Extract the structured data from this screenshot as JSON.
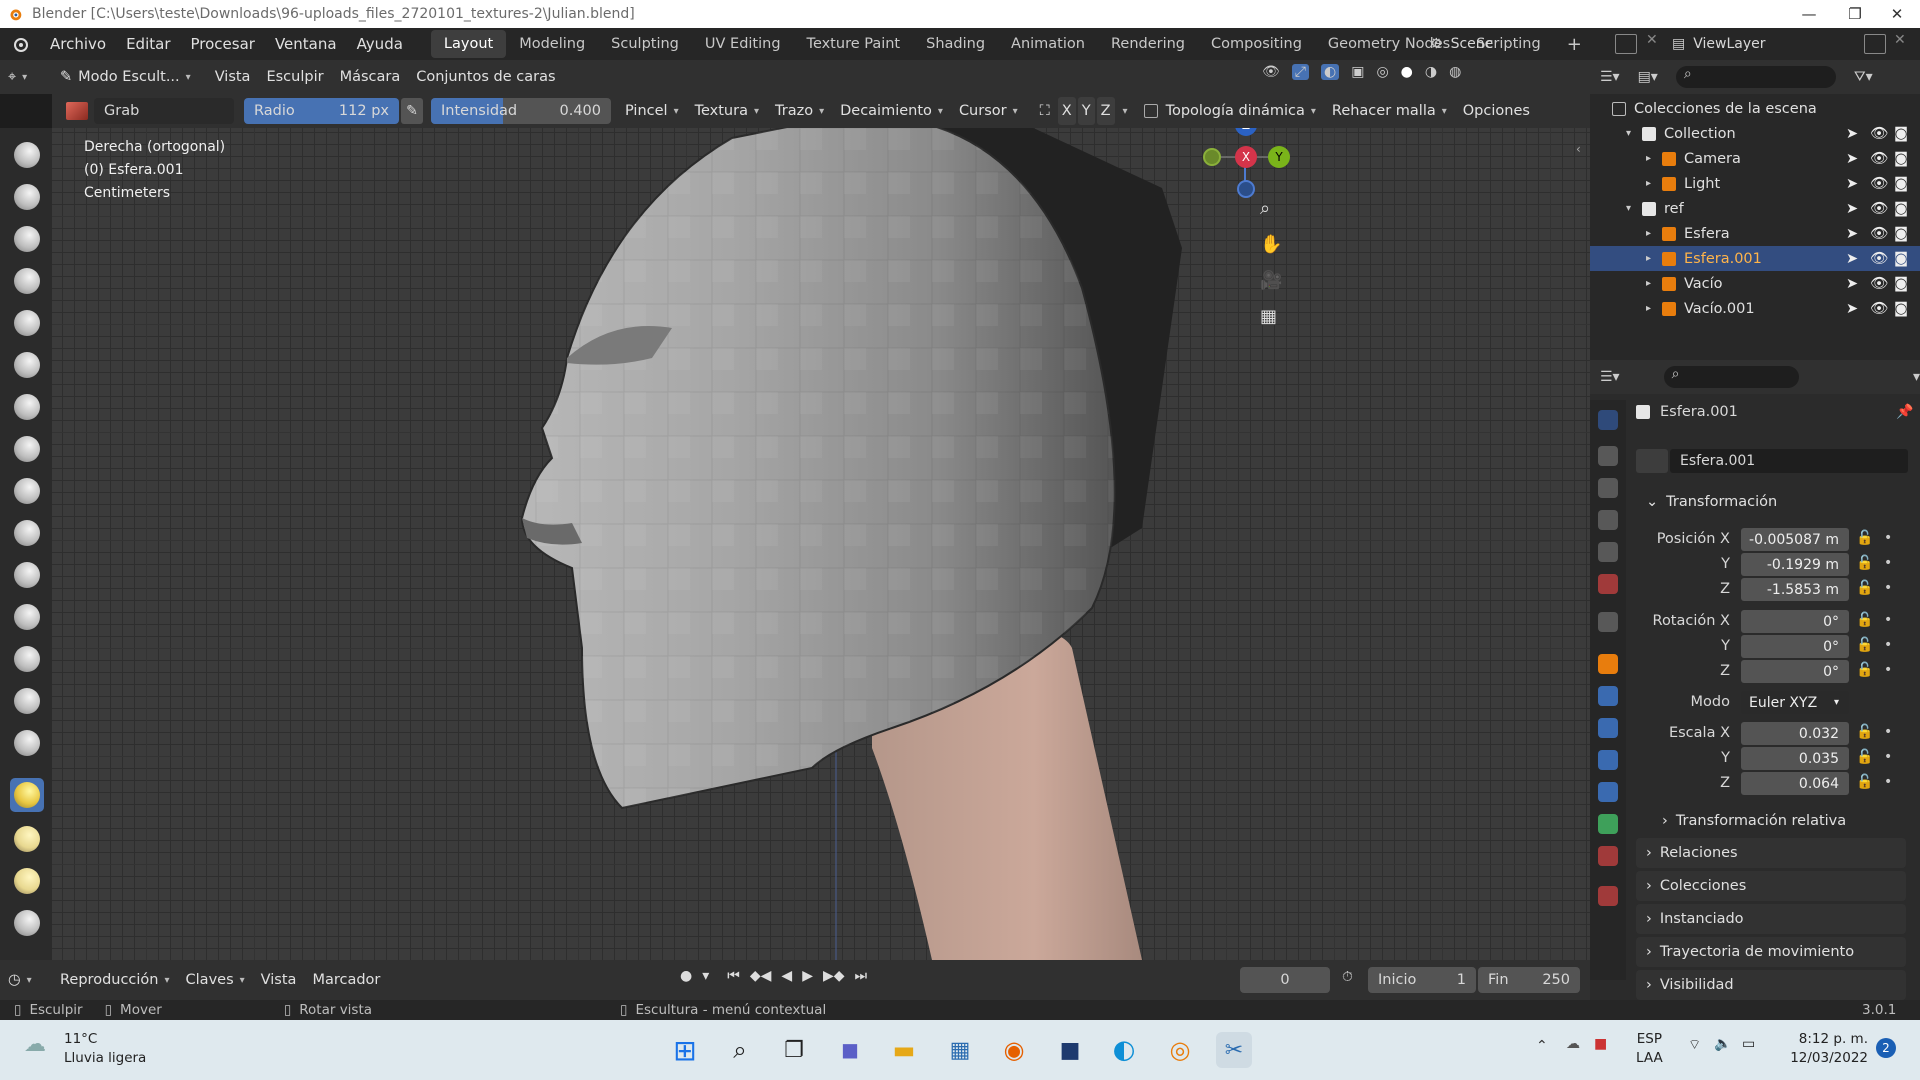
{
  "window": {
    "title": "Blender [C:\\Users\\teste\\Downloads\\96-uploads_files_2720101_textures-2\\Julian.blend]"
  },
  "menu": [
    "Archivo",
    "Editar",
    "Procesar",
    "Ventana",
    "Ayuda"
  ],
  "workspaces": [
    "Layout",
    "Modeling",
    "Sculpting",
    "UV Editing",
    "Texture Paint",
    "Shading",
    "Animation",
    "Rendering",
    "Compositing",
    "Geometry Nodes",
    "Scripting"
  ],
  "active_workspace": "Layout",
  "scene": "Scene",
  "view_layer": "ViewLayer",
  "header": {
    "mode": "Modo Escult...",
    "menus": [
      "Vista",
      "Esculpir",
      "Máscara",
      "Conjuntos de caras"
    ]
  },
  "tool_settings": {
    "brush": "Grab",
    "radius_label": "Radio",
    "radius_value": "112 px",
    "strength_label": "Intensidad",
    "strength_value": "0.400",
    "strength_fraction": 0.4,
    "dropdowns": [
      "Pincel",
      "Textura",
      "Trazo",
      "Decaimiento",
      "Cursor"
    ],
    "axes": [
      "X",
      "Y",
      "Z"
    ],
    "dyntopo": "Topología dinámica",
    "remesh": "Rehacer malla",
    "options": "Opciones"
  },
  "viewport_info": [
    "Derecha (ortogonal)",
    "(0) Esfera.001",
    "Centimeters"
  ],
  "gizmo": {
    "z": "Z",
    "x": "X",
    "y": "Y"
  },
  "outliner": {
    "root": "Colecciones de la escena",
    "items": [
      {
        "name": "Collection",
        "indent": 1
      },
      {
        "name": "Camera",
        "indent": 2
      },
      {
        "name": "Light",
        "indent": 2
      },
      {
        "name": "ref",
        "indent": 1
      },
      {
        "name": "Esfera",
        "indent": 2
      },
      {
        "name": "Esfera.001",
        "indent": 2,
        "selected": true
      },
      {
        "name": "Vacío",
        "indent": 2
      },
      {
        "name": "Vacío.001",
        "indent": 2
      }
    ]
  },
  "properties": {
    "object_name": "Esfera.001",
    "object_field": "Esfera.001",
    "section": "Transformación",
    "location_label": "Posición X",
    "location": [
      "-0.005087 m",
      "-0.1929 m",
      "-1.5853 m"
    ],
    "rotation_label": "Rotación X",
    "rotation": [
      "0°",
      "0°",
      "0°"
    ],
    "mode_label": "Modo",
    "mode_value": "Euler XYZ",
    "scale_label": "Escala X",
    "scale": [
      "0.032",
      "0.035",
      "0.064"
    ],
    "y_label": "Y",
    "z_label": "Z",
    "delta": "Transformación relativa",
    "sections": [
      "Relaciones",
      "Colecciones",
      "Instanciado",
      "Trayectoria de movimiento",
      "Visibilidad"
    ]
  },
  "timeline": {
    "menus": [
      "Reproducción",
      "Claves",
      "Vista",
      "Marcador"
    ],
    "frame": "0",
    "start_label": "Inicio",
    "start": "1",
    "end_label": "Fin",
    "end": "250"
  },
  "statusbar": {
    "items": [
      "Esculpir",
      "Mover",
      "Rotar vista",
      "Escultura - menú contextual"
    ],
    "version": "3.0.1"
  },
  "taskbar": {
    "temp": "11°C",
    "weather": "Lluvia ligera",
    "lang1": "ESP",
    "lang2": "LAA",
    "time": "8:12 p. m.",
    "date": "12/03/2022",
    "notif": "2"
  },
  "colors": {
    "accent": "#4772b3",
    "selected_row": "#334d80",
    "orange": "#e87d0d"
  }
}
